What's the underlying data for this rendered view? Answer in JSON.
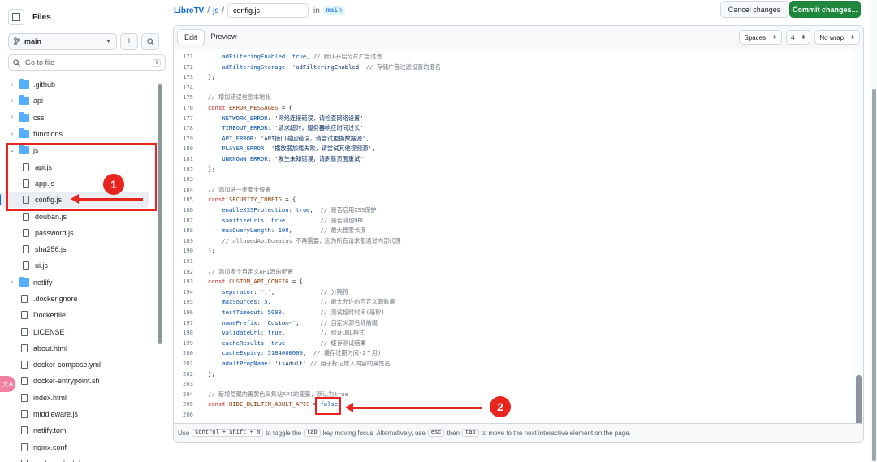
{
  "sidebar": {
    "title": "Files",
    "branch": "main",
    "goto_placeholder": "Go to file",
    "goto_shortcut": "t",
    "tree": [
      {
        "type": "folder",
        "label": ".github",
        "open": false,
        "depth": 0
      },
      {
        "type": "folder",
        "label": "api",
        "open": false,
        "depth": 0
      },
      {
        "type": "folder",
        "label": "css",
        "open": false,
        "depth": 0
      },
      {
        "type": "folder",
        "label": "functions",
        "open": false,
        "depth": 0
      },
      {
        "type": "folder",
        "label": "js",
        "open": true,
        "depth": 0
      },
      {
        "type": "file",
        "label": "api.js",
        "depth": 1
      },
      {
        "type": "file",
        "label": "app.js",
        "depth": 1
      },
      {
        "type": "file",
        "label": "config.js",
        "depth": 1,
        "selected": true
      },
      {
        "type": "file",
        "label": "douban.js",
        "depth": 1
      },
      {
        "type": "file",
        "label": "password.js",
        "depth": 1
      },
      {
        "type": "file",
        "label": "sha256.js",
        "depth": 1
      },
      {
        "type": "file",
        "label": "ui.js",
        "depth": 1
      },
      {
        "type": "folder",
        "label": "netlify",
        "open": false,
        "depth": 0
      },
      {
        "type": "file",
        "label": ".dockerignore",
        "depth": 0
      },
      {
        "type": "file",
        "label": "Dockerfile",
        "depth": 0
      },
      {
        "type": "file",
        "label": "LICENSE",
        "depth": 0
      },
      {
        "type": "file",
        "label": "about.html",
        "depth": 0
      },
      {
        "type": "file",
        "label": "docker-compose.yml",
        "depth": 0
      },
      {
        "type": "file",
        "label": "docker-entrypoint.sh",
        "depth": 0
      },
      {
        "type": "file",
        "label": "index.html",
        "depth": 0
      },
      {
        "type": "file",
        "label": "middleware.js",
        "depth": 0
      },
      {
        "type": "file",
        "label": "netlify.toml",
        "depth": 0
      },
      {
        "type": "file",
        "label": "nginx.conf",
        "depth": 0
      },
      {
        "type": "file",
        "label": "package-lock.json",
        "depth": 0
      }
    ]
  },
  "breadcrumb": {
    "repo": "LibreTV",
    "sep": "/",
    "folder": "js",
    "filename": "config.js",
    "in_label": "in",
    "branch": "main"
  },
  "actions": {
    "cancel": "Cancel changes",
    "commit": "Commit changes..."
  },
  "editor": {
    "tab_edit": "Edit",
    "tab_preview": "Preview",
    "indent_mode": "Spaces",
    "indent_size": "4",
    "wrap_mode": "No wrap",
    "footer": {
      "use": "Use",
      "keys": "Control + Shift + m",
      "text1": "to toggle the",
      "tab_key": "tab",
      "text2": "key moving focus. Alternatively, use",
      "esc_key": "esc",
      "then": "then",
      "tab_key2": "tab",
      "text3": "to move to the next interactive element on the page."
    },
    "lines": [
      {
        "n": "171",
        "t": "    adFilteringEnabled: true, // 默认开启分片广告过滤"
      },
      {
        "n": "172",
        "t": "    adFilteringStorage: 'adFilteringEnabled' // 存储广告过滤设置的键名"
      },
      {
        "n": "173",
        "t": "};"
      },
      {
        "n": "174",
        "t": ""
      },
      {
        "n": "175",
        "t": "// 增加错误信息本地化"
      },
      {
        "n": "176",
        "t": "const ERROR_MESSAGES = {"
      },
      {
        "n": "177",
        "t": "    NETWORK_ERROR: '网络连接错误，请检查网络设置',"
      },
      {
        "n": "178",
        "t": "    TIMEOUT_ERROR: '请求超时，服务器响应时间过长',"
      },
      {
        "n": "179",
        "t": "    API_ERROR: 'API接口返回错误，请尝试更换数据源',"
      },
      {
        "n": "180",
        "t": "    PLAYER_ERROR: '播放器加载失败，请尝试其他视频源',"
      },
      {
        "n": "181",
        "t": "    UNKNOWN_ERROR: '发生未知错误，请刷新页面重试'"
      },
      {
        "n": "182",
        "t": "};"
      },
      {
        "n": "183",
        "t": ""
      },
      {
        "n": "184",
        "t": "// 添加进一步安全设置"
      },
      {
        "n": "185",
        "t": "const SECURITY_CONFIG = {"
      },
      {
        "n": "186",
        "t": "    enableXSSProtection: true,  // 是否启用XSS保护"
      },
      {
        "n": "187",
        "t": "    sanitizeUrls: true,         // 是否清理URL"
      },
      {
        "n": "188",
        "t": "    maxQueryLength: 100,        // 最大搜索长度"
      },
      {
        "n": "189",
        "t": "    // allowedApiDomains 不再需要，因为所有请求都通过内部代理"
      },
      {
        "n": "190",
        "t": "};"
      },
      {
        "n": "191",
        "t": ""
      },
      {
        "n": "192",
        "t": "// 添加多个自定义API源的配置"
      },
      {
        "n": "193",
        "t": "const CUSTOM_API_CONFIG = {"
      },
      {
        "n": "194",
        "t": "    separator: ',',             // 分隔符"
      },
      {
        "n": "195",
        "t": "    maxSources: 5,              // 最大允许的自定义源数量"
      },
      {
        "n": "196",
        "t": "    testTimeout: 5000,          // 测试超时时间(毫秒)"
      },
      {
        "n": "197",
        "t": "    namePrefix: 'Custom-',      // 自定义源名称前缀"
      },
      {
        "n": "198",
        "t": "    validateUrl: true,          // 验证URL格式"
      },
      {
        "n": "199",
        "t": "    cacheResults: true,         // 缓存测试结果"
      },
      {
        "n": "200",
        "t": "    cacheExpiry: 5184000000,  // 缓存过期时间(2个月)"
      },
      {
        "n": "201",
        "t": "    adultPropName: 'isAdult' // 用于标记成人内容的属性名"
      },
      {
        "n": "202",
        "t": "};"
      },
      {
        "n": "203",
        "t": ""
      },
      {
        "n": "204",
        "t": "// 新增隐藏内置黄色采集站API的变量，默认为true"
      },
      {
        "n": "205",
        "t": "const HIDE_BUILTIN_ADULT_APIS = false;"
      },
      {
        "n": "206",
        "t": ""
      }
    ]
  },
  "annotations": {
    "badge1": "1",
    "badge2": "2",
    "color": "#e8241f"
  },
  "ext_pill": "文A"
}
